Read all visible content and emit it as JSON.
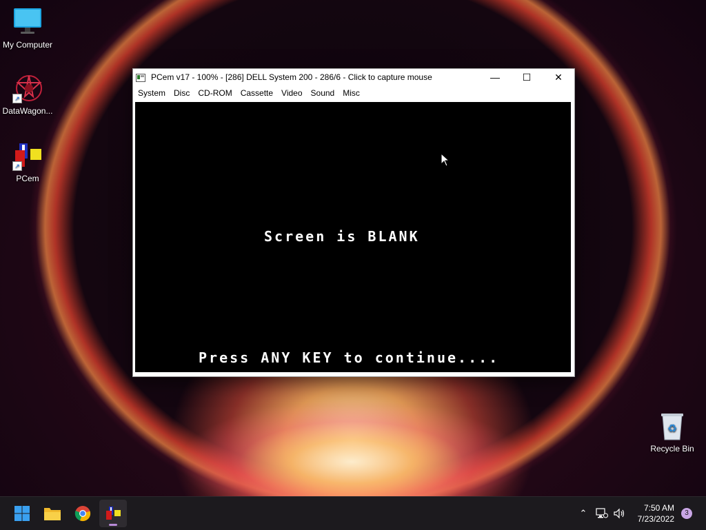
{
  "desktop": {
    "icons": [
      {
        "label": "My Computer",
        "icon": "monitor-icon"
      },
      {
        "label": "DataWagon...",
        "icon": "datawagon-icon"
      },
      {
        "label": "PCem",
        "icon": "pcem-icon"
      },
      {
        "label": "Recycle Bin",
        "icon": "recycle-bin-icon"
      }
    ]
  },
  "window": {
    "title": "PCem v17 - 100% - [286] DELL System 200 - 286/6 - Click to capture mouse",
    "controls": {
      "minimize": "—",
      "maximize": "☐",
      "close": "✕"
    },
    "menu": [
      "System",
      "Disc",
      "CD-ROM",
      "Cassette",
      "Video",
      "Sound",
      "Misc"
    ],
    "screen": {
      "line1": "Screen is BLANK",
      "line2": "Press ANY KEY to continue...."
    }
  },
  "taskbar": {
    "apps": [
      {
        "name": "start",
        "icon": "windows-start-icon"
      },
      {
        "name": "file-explorer",
        "icon": "folder-icon"
      },
      {
        "name": "chrome",
        "icon": "chrome-icon"
      },
      {
        "name": "pcem",
        "icon": "pcem-icon",
        "active": true
      }
    ],
    "clock": {
      "time": "7:50 AM",
      "date": "7/23/2022"
    },
    "notifications": "3"
  },
  "colors": {
    "taskbar": "#1c1a1e",
    "accent": "#b88ad8",
    "screen": "#000000"
  }
}
